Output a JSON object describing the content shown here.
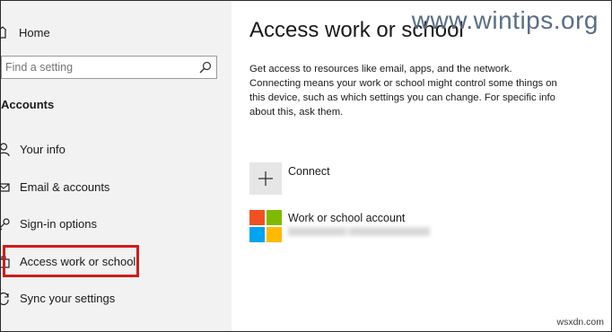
{
  "sidebar": {
    "home_label": "Home",
    "search_placeholder": "Find a setting",
    "section_title": "Accounts",
    "items": [
      {
        "label": "Your info",
        "icon": "person-icon"
      },
      {
        "label": "Email & accounts",
        "icon": "mail-icon"
      },
      {
        "label": "Sign-in options",
        "icon": "key-icon"
      },
      {
        "label": "Access work or school",
        "icon": "briefcase-icon"
      },
      {
        "label": "Sync your settings",
        "icon": "sync-icon"
      }
    ]
  },
  "main": {
    "title": "Access work or school",
    "description": "Get access to resources like email, apps, and the network. Connecting means your work or school might control some things on this device, such as which settings you can change. For specific info about this, ask them.",
    "connect_label": "Connect",
    "account_label": "Work or school account"
  },
  "watermark": "www.wintips.org",
  "credit": "wsxdn.com",
  "colors": {
    "highlight": "#d01c1c",
    "sidebar_bg": "#f2f2f2",
    "ms_red": "#f25022",
    "ms_green": "#7fba00",
    "ms_blue": "#00a4ef",
    "ms_yellow": "#ffb900"
  }
}
